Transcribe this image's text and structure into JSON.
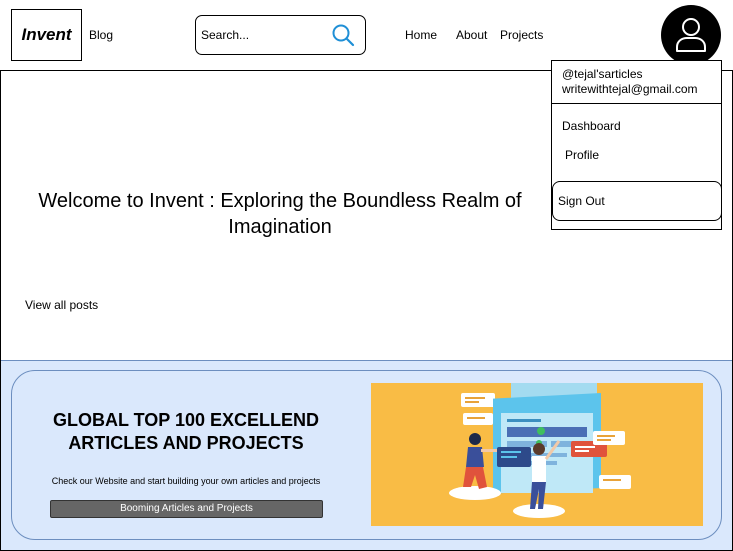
{
  "header": {
    "logo": "Invent",
    "blog": "Blog",
    "search_placeholder": "Search...",
    "nav": {
      "home": "Home",
      "about": "About",
      "projects": "Projects"
    }
  },
  "dropdown": {
    "handle": "@tejal'sarticles",
    "email": "writewithtejal@gmail.com",
    "dashboard": "Dashboard",
    "profile": "Profile",
    "signout": "Sign Out"
  },
  "main": {
    "welcome": "Welcome to Invent : Exploring the Boundless Realm of Imagination",
    "view_all": "View all posts"
  },
  "banner": {
    "title": "GLOBAL TOP 100 EXCELLEND ARTICLES AND PROJECTS",
    "subtitle": "Check our Website and start building your own articles and projects",
    "button": "Booming Articles and Projects"
  },
  "colors": {
    "banner_bg": "#dae8fc",
    "banner_border": "#6c8ebf",
    "illustration_bg": "#f9bc45",
    "search_icon": "#1f8fd6",
    "button_bg": "#666666"
  },
  "icons": {
    "search": "search-icon",
    "avatar": "user-icon"
  }
}
